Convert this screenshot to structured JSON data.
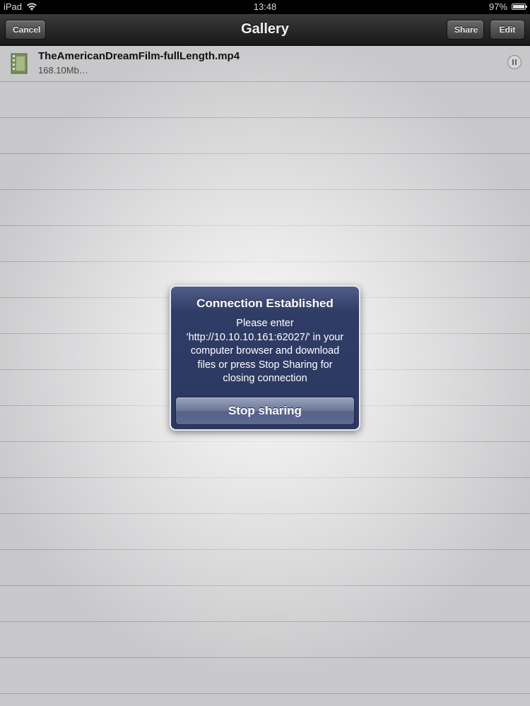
{
  "status_bar": {
    "carrier": "iPad",
    "time": "13:48",
    "battery": "97%",
    "battery_level": 0.97
  },
  "nav_bar": {
    "title": "Gallery",
    "cancel_label": "Cancel",
    "share_label": "Share",
    "edit_label": "Edit"
  },
  "files": [
    {
      "name": "TheAmericanDreamFilm-fullLength.mp4",
      "size": "168.10Mb…"
    }
  ],
  "alert": {
    "title": "Connection Established",
    "message_lines": [
      "Please enter",
      "'http://10.10.10.161:62027/' in your",
      "computer browser and download",
      "files or press Stop Sharing for",
      "closing connection"
    ],
    "button_label": "Stop sharing"
  },
  "icons": {
    "wifi": "wifi-icon",
    "battery": "battery-icon",
    "file": "video-file-icon",
    "pause": "pause-icon"
  },
  "colors": {
    "alert_background": "#2f3c66",
    "nav_background": "#242424"
  }
}
